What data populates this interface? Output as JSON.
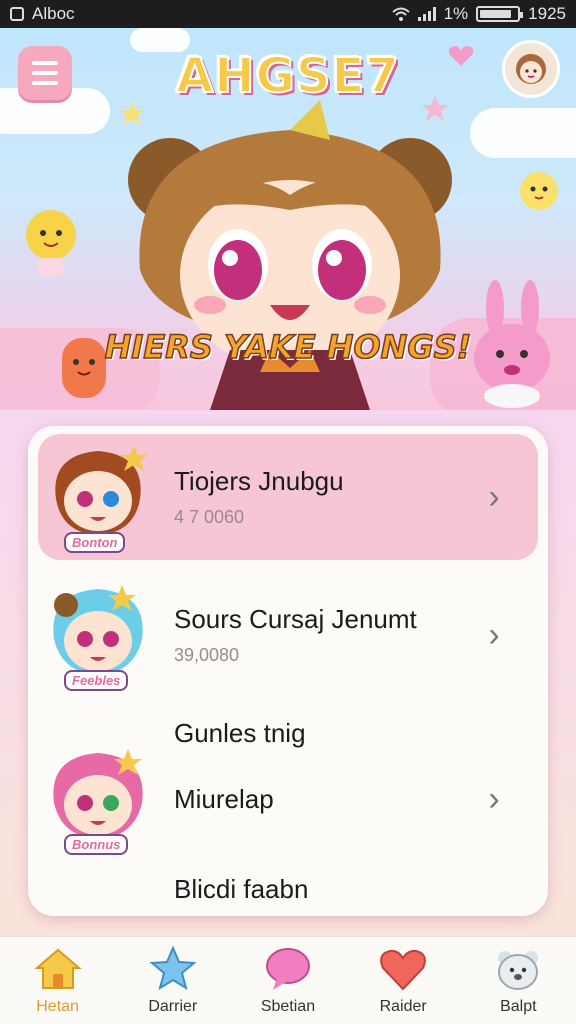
{
  "status_bar": {
    "app_name": "Alboc",
    "signal_text": "1%",
    "battery_level": 0.85,
    "time": "1925"
  },
  "hero": {
    "app_title": "AHGSE7",
    "banner_text": "HIERS YAKE HONGS!"
  },
  "list": {
    "items": [
      {
        "title": "Tiojers Jnubgu",
        "subtitle": "4 7 0060",
        "tag": "Bonton",
        "active": true
      },
      {
        "title": "Sours Cursaj Jenumt",
        "subtitle": "39,0080",
        "tag": "Feebles",
        "active": false
      },
      {
        "title": "Miurelap",
        "subtitle": "",
        "tag": "Bonnus",
        "active": false
      }
    ],
    "section_label": "Gunles tnig",
    "footer_label": "Blicdi faabn"
  },
  "bottom_nav": {
    "items": [
      {
        "label": "Hetan",
        "icon": "home-icon",
        "active": true
      },
      {
        "label": "Darrier",
        "icon": "star-icon",
        "active": false
      },
      {
        "label": "Sbetian",
        "icon": "chat-bubble-icon",
        "active": false
      },
      {
        "label": "Raider",
        "icon": "heart-icon",
        "active": false
      },
      {
        "label": "Balpt",
        "icon": "bear-icon",
        "active": false
      }
    ]
  },
  "colors": {
    "accent": "#e39a2a",
    "active_row": "#f7c6d4",
    "menu_button": "#f6a8bf"
  }
}
